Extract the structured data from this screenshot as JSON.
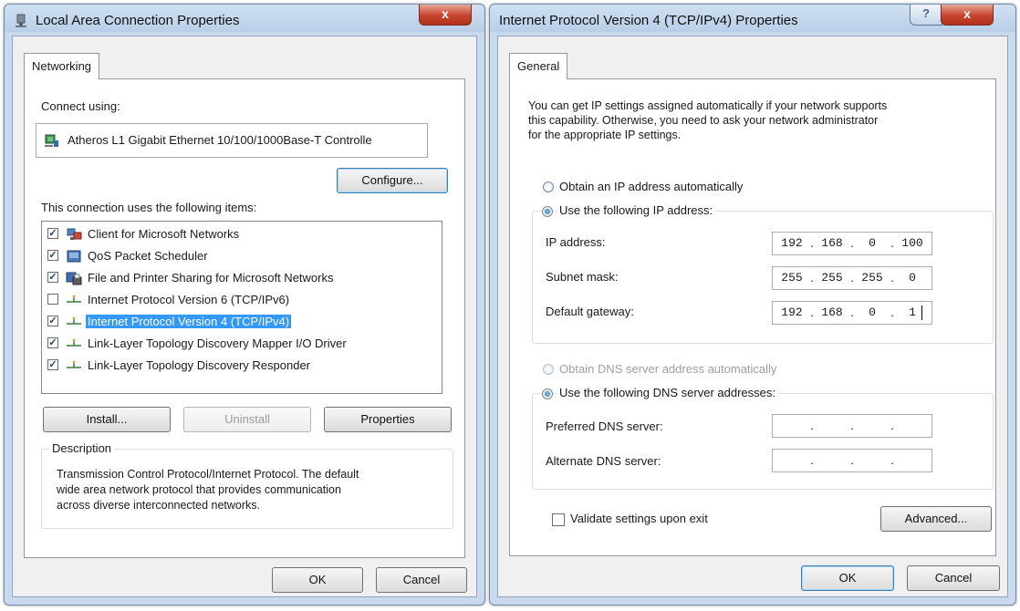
{
  "left_dialog": {
    "title": "Local Area Connection Properties",
    "close_label": "x",
    "tab": "Networking",
    "connect_using_label": "Connect using:",
    "adapter_name": "Atheros L1 Gigabit Ethernet 10/100/1000Base-T Controlle",
    "configure_label": "Configure...",
    "items_label": "This connection uses the following items:",
    "items": [
      {
        "label": "Client for Microsoft Networks",
        "checked": true,
        "icon": "network-client-icon"
      },
      {
        "label": "QoS Packet Scheduler",
        "checked": true,
        "icon": "qos-icon"
      },
      {
        "label": "File and Printer Sharing for Microsoft Networks",
        "checked": true,
        "icon": "file-sharing-icon"
      },
      {
        "label": "Internet Protocol Version 6 (TCP/IPv6)",
        "checked": false,
        "icon": "protocol-icon"
      },
      {
        "label": "Internet Protocol Version 4 (TCP/IPv4)",
        "checked": true,
        "icon": "protocol-icon",
        "selected": true
      },
      {
        "label": "Link-Layer Topology Discovery Mapper I/O Driver",
        "checked": true,
        "icon": "protocol-icon"
      },
      {
        "label": "Link-Layer Topology Discovery Responder",
        "checked": true,
        "icon": "protocol-icon"
      }
    ],
    "install_label": "Install...",
    "uninstall_label": "Uninstall",
    "properties_label": "Properties",
    "description_title": "Description",
    "description_line1": "Transmission Control Protocol/Internet Protocol. The default",
    "description_line2": "wide area network protocol that provides communication",
    "description_line3": "across diverse interconnected networks.",
    "ok_label": "OK",
    "cancel_label": "Cancel"
  },
  "right_dialog": {
    "title": "Internet Protocol Version 4 (TCP/IPv4) Properties",
    "help_label": "?",
    "close_label": "x",
    "tab": "General",
    "intro_line1": "You can get IP settings assigned automatically if your network supports",
    "intro_line2": "this capability. Otherwise, you need to ask your network administrator",
    "intro_line3": "for the appropriate IP settings.",
    "obtain_ip_auto": "Obtain an IP address automatically",
    "use_following_ip": "Use the following IP address:",
    "ip_address_label": "IP address:",
    "ip_address": [
      "192",
      "168",
      "0",
      "100"
    ],
    "subnet_mask_label": "Subnet mask:",
    "subnet_mask": [
      "255",
      "255",
      "255",
      "0"
    ],
    "default_gateway_label": "Default gateway:",
    "default_gateway": [
      "192",
      "168",
      "0",
      "1"
    ],
    "obtain_dns_auto": "Obtain DNS server address automatically",
    "use_following_dns": "Use the following DNS server addresses:",
    "preferred_dns_label": "Preferred DNS server:",
    "alternate_dns_label": "Alternate DNS server:",
    "validate_label": "Validate settings upon exit",
    "advanced_label": "Advanced...",
    "ok_label": "OK",
    "cancel_label": "Cancel"
  }
}
